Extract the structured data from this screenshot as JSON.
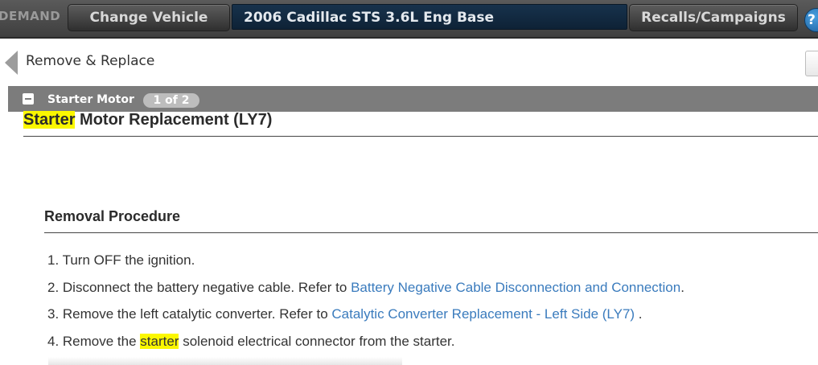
{
  "topbar": {
    "brand": "DEMAND",
    "change_vehicle": "Change Vehicle",
    "vehicle": "2006 Cadillac STS 3.6L Eng Base",
    "recalls": "Recalls/Campaigns",
    "help": "?"
  },
  "breadcrumb": {
    "label": "Remove & Replace"
  },
  "section": {
    "title": "Starter Motor",
    "pager": "1 of 2"
  },
  "document": {
    "title_highlight": "Starter",
    "title_rest": " Motor Replacement (LY7)",
    "subheading": "Removal Procedure",
    "steps": [
      {
        "num": "1. ",
        "text": "Turn OFF the ignition."
      },
      {
        "num": "2. ",
        "text": "Disconnect the battery negative cable. Refer to ",
        "link": "Battery Negative Cable Disconnection and Connection",
        "after": "."
      },
      {
        "num": "3. ",
        "text": "Remove the left catalytic converter. Refer to ",
        "link": "Catalytic Converter Replacement - Left Side (LY7)",
        "after": " ."
      },
      {
        "num": "4. ",
        "text": "Remove the ",
        "highlight": "starter",
        "after": " solenoid electrical connector from the starter."
      }
    ]
  },
  "colors": {
    "highlight": "#fbf700",
    "link": "#3a7bbd",
    "section_bar": "#7c7c7c"
  }
}
